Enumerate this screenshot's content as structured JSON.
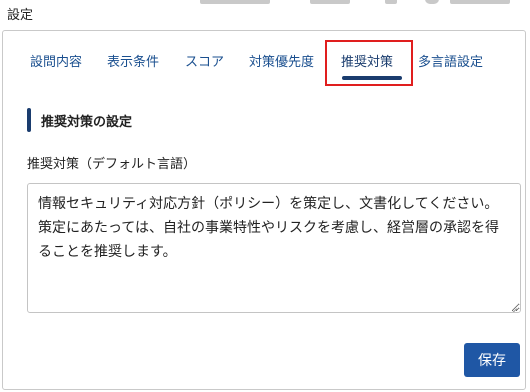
{
  "window": {
    "title": "設定"
  },
  "tabs": [
    {
      "label": "設問内容"
    },
    {
      "label": "表示条件"
    },
    {
      "label": "スコア"
    },
    {
      "label": "対策優先度"
    },
    {
      "label": "推奨対策",
      "active": true
    },
    {
      "label": "多言語設定"
    }
  ],
  "section": {
    "heading": "推奨対策の設定"
  },
  "field": {
    "label": "推奨対策（デフォルト言語）",
    "value": "情報セキュリティ対応方針（ポリシー）を策定し、文書化してください。策定にあたっては、自社の事業特性やリスクを考慮し、経営層の承認を得ることを推奨します。"
  },
  "actions": {
    "save_label": "保存"
  },
  "colors": {
    "accent": "#1f57a5",
    "tab_text": "#1a4f8f",
    "active_underline": "#1a3c6e",
    "highlight": "#e01e1e"
  }
}
